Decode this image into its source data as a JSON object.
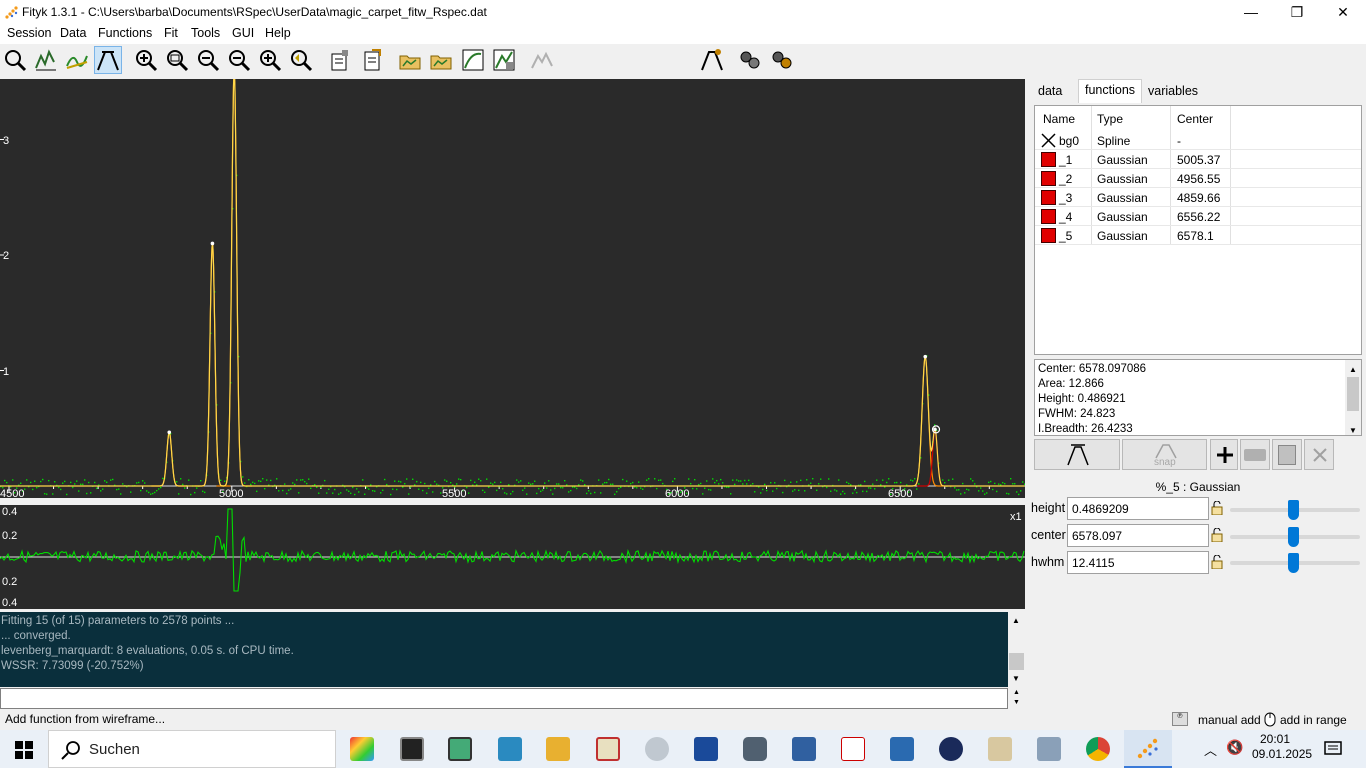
{
  "window": {
    "title": "Fityk 1.3.1 - C:\\Users\\barba\\Documents\\RSpec\\UserData\\magic_carpet_fitw_Rspec.dat",
    "min": "—",
    "max": "❐",
    "close": "✕"
  },
  "menu": [
    "Session",
    "Data",
    "Functions",
    "Fit",
    "Tools",
    "GUI",
    "Help"
  ],
  "toolbar": {
    "function_type": "Gaussian"
  },
  "plot": {
    "y_ticks": [
      "3",
      "2",
      "1"
    ],
    "x_ticks": [
      "4500",
      "5000",
      "5500",
      "6000",
      "6500"
    ],
    "resid_ticks": [
      "0.4",
      "0.2",
      "0.2",
      "0.4"
    ],
    "resid_scale": "x1",
    "colors": {
      "background": "#2a2a2a",
      "data": "#00dd00",
      "model": "#ffd84a",
      "peaks": "#ff8a00",
      "selected": "#cc0000"
    }
  },
  "log": {
    "lines": [
      "Fitting 15 (of 15) parameters to 2578 points ...",
      "... converged.",
      "levenberg_marquardt: 8 evaluations, 0.05 s. of CPU time.",
      "WSSR: 7.73099 (-20.752%)"
    ]
  },
  "status": {
    "text": "Add function from wireframe...",
    "mode1": "manual add",
    "mode2": "add in range"
  },
  "right_panel": {
    "tabs": [
      "data",
      "functions",
      "variables"
    ],
    "headers": [
      "Name",
      "Type",
      "Center"
    ],
    "rows": [
      {
        "name": "bg0",
        "type": "Spline",
        "center": "-"
      },
      {
        "name": "_1",
        "type": "Gaussian",
        "center": "5005.37"
      },
      {
        "name": "_2",
        "type": "Gaussian",
        "center": "4956.55"
      },
      {
        "name": "_3",
        "type": "Gaussian",
        "center": "4859.66"
      },
      {
        "name": "_4",
        "type": "Gaussian",
        "center": "6556.22"
      },
      {
        "name": "_5",
        "type": "Gaussian",
        "center": "6578.1"
      }
    ],
    "info": [
      "Center: 6578.097086",
      "Area: 12.866",
      "Height: 0.486921",
      "FWHM: 24.823",
      "I.Breadth: 26.4233"
    ],
    "snap_label": "snap",
    "function_title": "%_5 : Gaussian",
    "params": [
      {
        "label": "height",
        "value": "0.4869209"
      },
      {
        "label": "center",
        "value": "6578.097"
      },
      {
        "label": "hwhm",
        "value": "12.4115"
      }
    ]
  },
  "taskbar": {
    "search": "Suchen",
    "time": "20:01",
    "date": "09.01.2025"
  }
}
